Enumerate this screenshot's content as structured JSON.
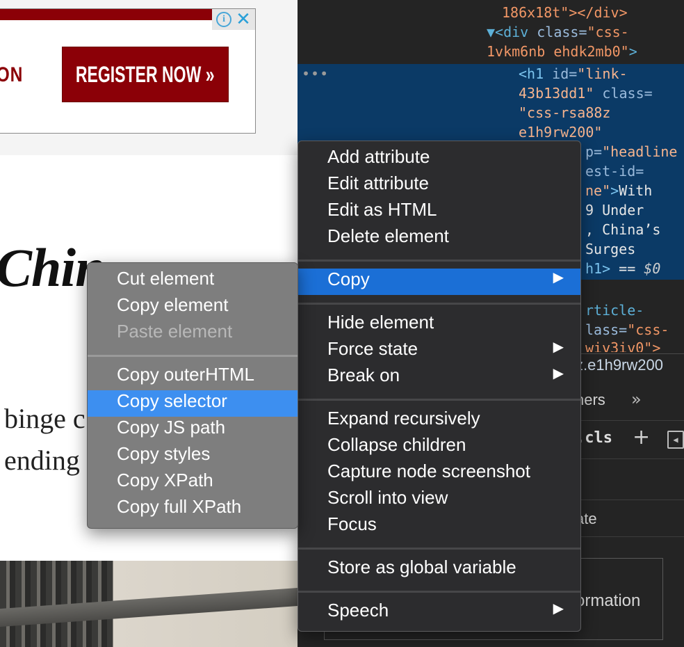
{
  "webpage": {
    "ad": {
      "fragment_text": "ION",
      "register_label": "REGISTER NOW »",
      "choices_icon": "i",
      "close_icon": "✕"
    },
    "headline_fragment": "Chin",
    "body_lines": [
      "binge c",
      "ending"
    ]
  },
  "devtools": {
    "code_lines": {
      "l1": "186x18t\"></div>",
      "l2_tag": "▼<div ",
      "l2_attr": "class=",
      "l2_str": "\"css-",
      "l3_str": "1vkm6nb ehdk2mb0\"",
      "l3_tag": ">",
      "l4_tag": "<h1 ",
      "l4_attr": "id=",
      "l4_str": "\"link-",
      "l5_str": "43b13dd1\"",
      "l5_attr": " class=",
      "l6_str": "\"css-rsa88z",
      "l7_str": "e1h9rw200\"",
      "l8_attr": "p=",
      "l8_str": "\"headline",
      "l9_attr": "est-id=",
      "l10_str": "ne\"",
      "l10_tag": ">",
      "l10_text": "With",
      "l11": "9 Under",
      "l12": ", China’s",
      "l13": " Surges",
      "l14_tag": "h1>",
      "l14_eq": " == ",
      "l14_var": "$0",
      "l15_tag": "rticle-",
      "l16_attr": "lass=",
      "l16_str": "\"css-",
      "l17": "wiv3iv0\">"
    },
    "dots": "•••",
    "breadcrumb": "z.e1h9rw200",
    "tab_fragment": "ners",
    "more_tabs_icon": "»",
    "cls_label": ".cls",
    "add_icon": "+",
    "filter_fragment": "ate",
    "info_fragment": "ormation"
  },
  "context_menu": {
    "items": {
      "add_attribute": "Add attribute",
      "edit_attribute": "Edit attribute",
      "edit_as_html": "Edit as HTML",
      "delete_element": "Delete element",
      "copy": "Copy",
      "hide_element": "Hide element",
      "force_state": "Force state",
      "break_on": "Break on",
      "expand_recursively": "Expand recursively",
      "collapse_children": "Collapse children",
      "capture_node_screenshot": "Capture node screenshot",
      "scroll_into_view": "Scroll into view",
      "focus": "Focus",
      "store_as_global_variable": "Store as global variable",
      "speech": "Speech"
    },
    "arrow": "▶",
    "highlighted": "Copy"
  },
  "copy_submenu": {
    "items": {
      "cut_element": "Cut element",
      "copy_element": "Copy element",
      "paste_element": "Paste element",
      "copy_outerhtml": "Copy outerHTML",
      "copy_selector": "Copy selector",
      "copy_js_path": "Copy JS path",
      "copy_styles": "Copy styles",
      "copy_xpath": "Copy XPath",
      "copy_full_xpath": "Copy full XPath"
    },
    "disabled": "Paste element",
    "highlighted": "Copy selector"
  }
}
